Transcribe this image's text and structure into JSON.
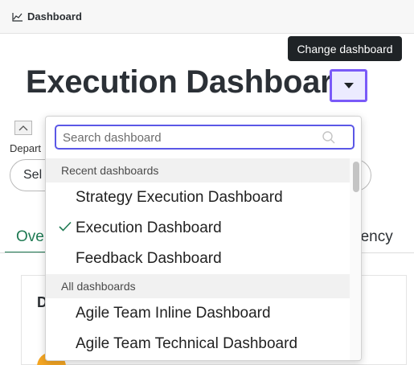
{
  "breadcrumb": {
    "label": "Dashboard",
    "icon": "line-chart-icon"
  },
  "tooltip": "Change dashboard",
  "page_title": "Execution Dashboard",
  "background": {
    "department_label": "Depart",
    "select_text": "Sel",
    "tab_overview": "Ove",
    "tab_dependency": "dency",
    "card_initial": "D"
  },
  "dropdown": {
    "search_placeholder": "Search dashboard",
    "groups": [
      {
        "label": "Recent dashboards",
        "items": [
          {
            "label": "Strategy Execution Dashboard",
            "selected": false
          },
          {
            "label": "Execution Dashboard",
            "selected": true
          },
          {
            "label": "Feedback Dashboard",
            "selected": false
          }
        ]
      },
      {
        "label": "All dashboards",
        "items": [
          {
            "label": "Agile Team Inline Dashboard",
            "selected": false
          },
          {
            "label": "Agile Team Technical Dashboard",
            "selected": false
          }
        ]
      }
    ]
  },
  "colors": {
    "accent": "#5b57e6",
    "highlight_border": "#7a5af8",
    "tab_active": "#1f7a53",
    "check": "#1f7a53"
  }
}
